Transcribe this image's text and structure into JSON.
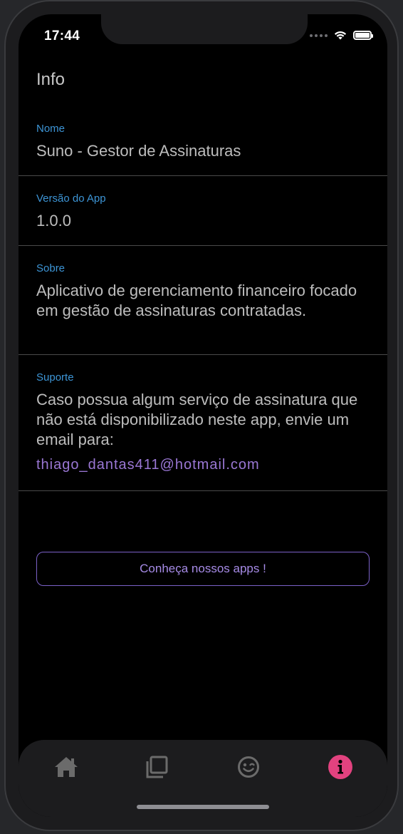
{
  "status_bar": {
    "time": "17:44"
  },
  "page": {
    "title": "Info"
  },
  "sections": [
    {
      "label": "Nome",
      "value": "Suno - Gestor de Assinaturas"
    },
    {
      "label": "Versão do App",
      "value": "1.0.0"
    },
    {
      "label": "Sobre",
      "value": "Aplicativo de gerenciamento financeiro focado em gestão de assinaturas contratadas."
    },
    {
      "label": "Suporte",
      "value": "Caso possua algum serviço de assinatura que não está disponibilizado neste app, envie um email para:",
      "email": "thiago_dantas411@hotmail.com"
    }
  ],
  "apps_button": {
    "label": "Conheça nossos apps !"
  },
  "bottom_nav": {
    "items": [
      {
        "icon": "home-icon",
        "active": false
      },
      {
        "icon": "copy-icon",
        "active": false
      },
      {
        "icon": "wink-face-icon",
        "active": false
      },
      {
        "icon": "info-icon",
        "active": true
      }
    ]
  },
  "colors": {
    "label_blue": "#3d95d6",
    "accent_purple": "#9a77d4",
    "active_pink": "#e2427f",
    "inactive_icon": "#6b6b6b",
    "background": "#000000"
  }
}
